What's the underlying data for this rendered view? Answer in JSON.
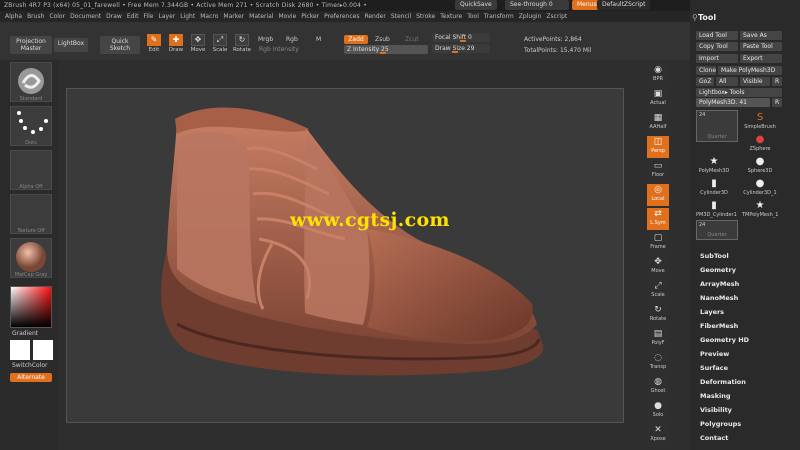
{
  "titlebar": {
    "text": "ZBrush 4R7 P3 (x64)    05_01_farewell    • Free Mem 7.344GB • Active Mem 271 • Scratch Disk 2680 • Timer▸0.004 • ",
    "quicksave": "QuickSave",
    "seethrough": "See-through  0",
    "menus": "Menus",
    "defaultzscript": "DefaultZScript"
  },
  "menubar": [
    "Alpha",
    "Brush",
    "Color",
    "Document",
    "Draw",
    "Edit",
    "File",
    "Layer",
    "Light",
    "Macro",
    "Marker",
    "Material",
    "Movie",
    "Picker",
    "Preferences",
    "Render",
    "Stencil",
    "Stroke",
    "Texture",
    "Tool",
    "Transform",
    "Zplugin",
    "Zscript"
  ],
  "shelf": {
    "projection_master": "Projection\nMaster",
    "lightbox": "LightBox",
    "quick_sketch": "Quick\nSketch",
    "edit": "Edit",
    "draw": "Draw",
    "move": "Move",
    "scale": "Scale",
    "rotate": "Rotate",
    "mrgb": "Mrgb",
    "rgb": "Rgb",
    "m": "M",
    "rgb_intensity": "Rgb Intensity",
    "zadd": "Zadd",
    "zsub": "Zsub",
    "zcut": "Zcut",
    "z_intensity": "Z Intensity 25",
    "focal_shift": "Focal Shift 0",
    "draw_size": "Draw Size 29",
    "active_points": "ActivePoints: 2,864",
    "total_points": "TotalPoints: 15,470 Mil"
  },
  "left": {
    "brush": "Standard",
    "stroke": "Dots",
    "alpha": "Alpha Off",
    "texture": "Texture Off",
    "material": "MatCap Gray",
    "gradient": "Gradient",
    "switchcolor": "SwitchColor",
    "alternate": "Alternate"
  },
  "right": [
    "BPR",
    "Actual",
    "AAHalf",
    "Persp",
    "Floor",
    "Local",
    "L.Sym",
    "Frame",
    "Move",
    "Scale",
    "Rotate",
    "PolyF",
    "Transp",
    "Ghost",
    "Solo",
    "Xpose"
  ],
  "tool": {
    "title": "Tool",
    "load": "Load Tool",
    "saveas": "Save As",
    "copy": "Copy Tool",
    "paste": "Paste Tool",
    "import": "Import",
    "export": "Export",
    "clone": "Clone",
    "make": "Make PolyMesh3D",
    "goz": "GoZ",
    "all": "All",
    "visible": "Visible",
    "r": "R",
    "lightbox_tools": "Lightbox▸ Tools",
    "current": "PolyMesh3D. 41",
    "r2": "R",
    "slots": [
      "SimpleBrush",
      "ZSphere",
      "PolyMesh3D",
      "Sphere3D",
      "Cylinder3D",
      "Cylinder3D_1",
      "PM3D_Cylinder1",
      "TMPolyMesh_1"
    ],
    "num24": "24",
    "quarter": "Quarter",
    "menu": [
      "SubTool",
      "Geometry",
      "ArrayMesh",
      "NanoMesh",
      "Layers",
      "FiberMesh",
      "Geometry HD",
      "Preview",
      "Surface",
      "Deformation",
      "Masking",
      "Visibility",
      "Polygroups",
      "Contact"
    ]
  },
  "watermark": "www.cgtsj.com",
  "colors": {
    "accent": "#e0701c",
    "model": "#b06a50"
  }
}
